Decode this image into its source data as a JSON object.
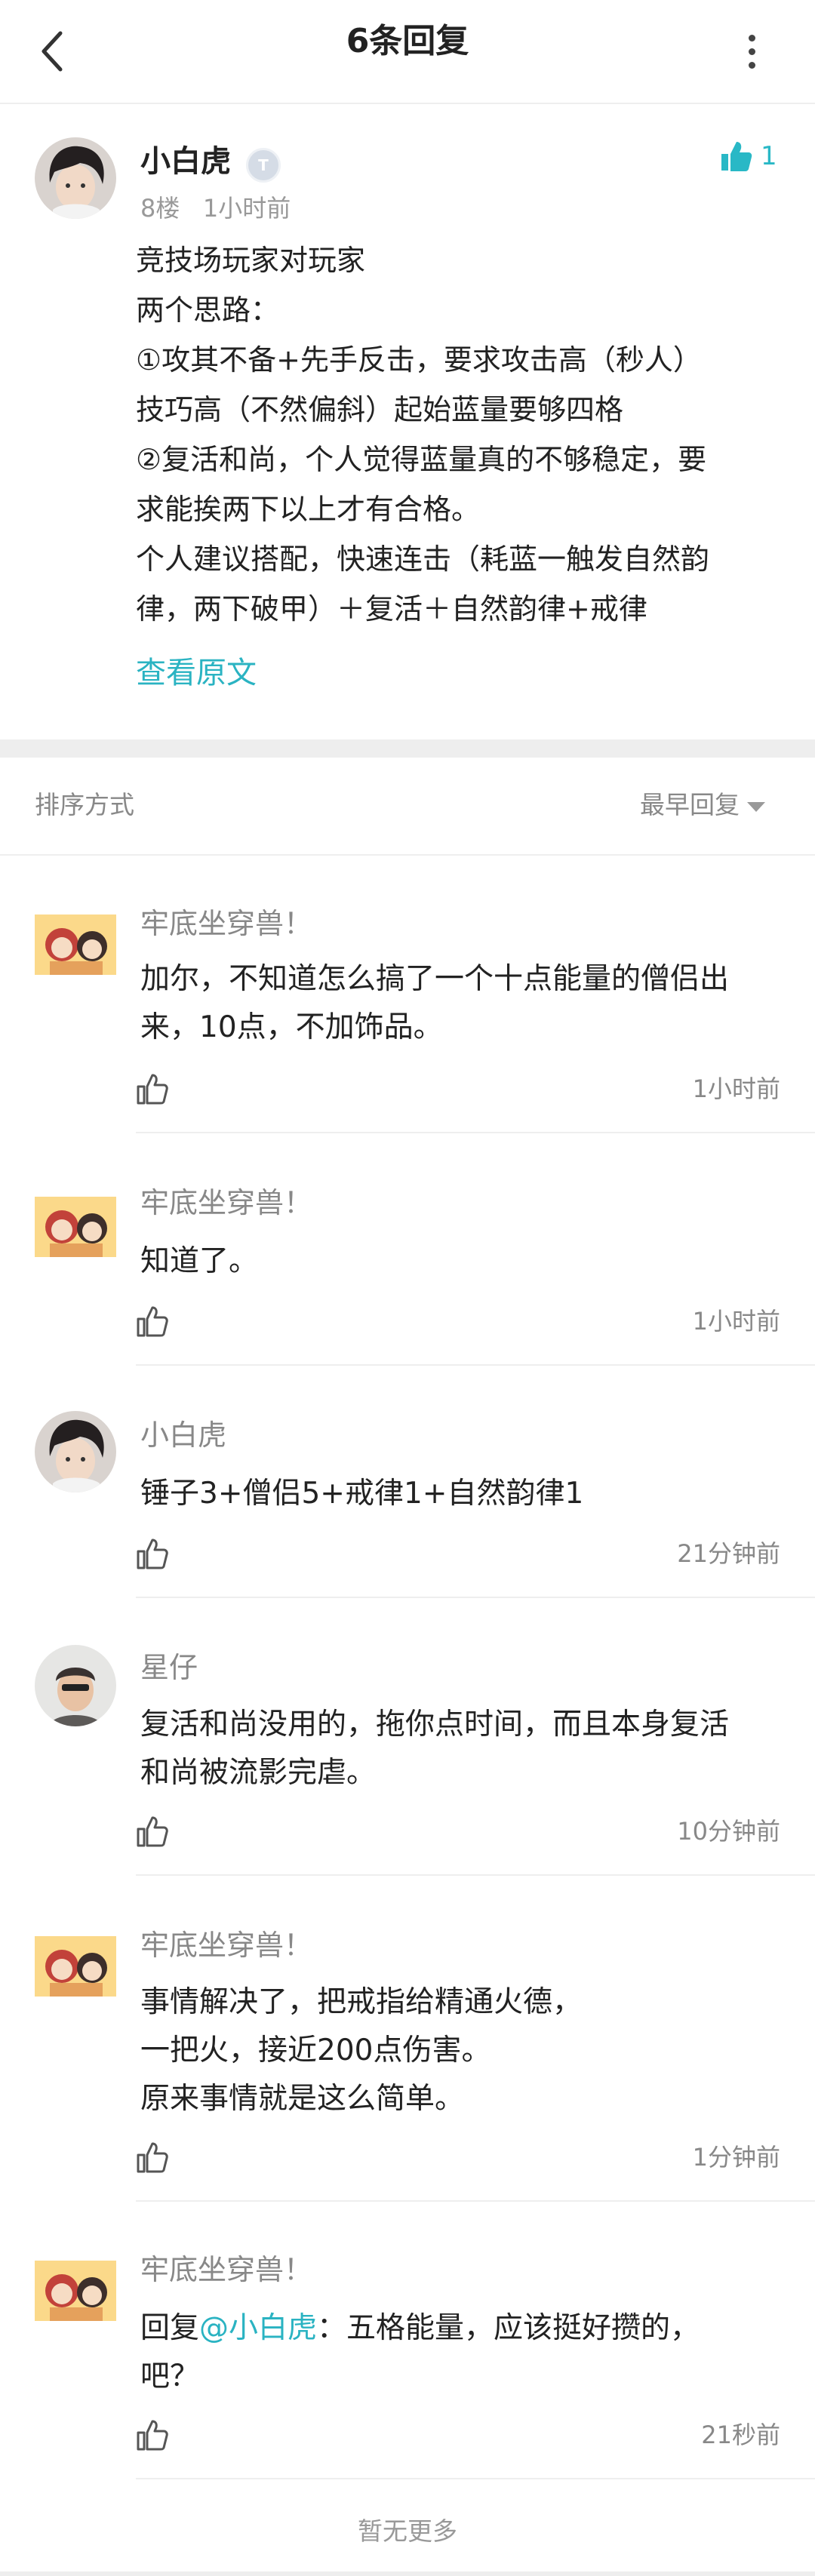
{
  "header": {
    "title": "6条回复",
    "back_icon": "chevron-left-icon",
    "more_icon": "more-vertical-icon"
  },
  "post": {
    "author": "小白虎",
    "badge_icon": "level-badge-icon",
    "floor": "8楼",
    "time": "1小时前",
    "likes": "1",
    "lines": [
      "竞技场玩家对玩家",
      "两个思路：",
      "①攻其不备+先手反击，要求攻击高（秒人）",
      "技巧高（不然偏斜）起始蓝量要够四格",
      "②复活和尚，个人觉得蓝量真的不够稳定，要",
      "求能挨两下以上才有合格。",
      "个人建议搭配，快速连击（耗蓝一触发自然韵",
      "律，两下破甲）＋复活＋自然韵律+戒律"
    ],
    "view_original": "查看原文"
  },
  "sort": {
    "label": "排序方式",
    "value": "最早回复"
  },
  "replies": [
    {
      "author": "牢底坐穿兽！",
      "lines": [
        "加尔，不知道怎么搞了一个十点能量的僧侣出",
        "来，10点，不加饰品。"
      ],
      "time": "1小时前"
    },
    {
      "author": "牢底坐穿兽！",
      "lines": [
        "知道了。"
      ],
      "time": "1小时前"
    },
    {
      "author": "小白虎",
      "lines": [
        "锤子3+僧侣5+戒律1+自然韵律1"
      ],
      "time": "21分钟前"
    },
    {
      "author": "星仔",
      "lines": [
        "复活和尚没用的，拖你点时间，而且本身复活",
        "和尚被流影完虐。"
      ],
      "time": "10分钟前"
    },
    {
      "author": "牢底坐穿兽！",
      "lines": [
        "事情解决了，把戒指给精通火德，",
        "一把火，接近200点伤害。",
        "原来事情就是这么简单。"
      ],
      "time": "1分钟前"
    },
    {
      "author": "牢底坐穿兽！",
      "reply_prefix": "回复",
      "mention": "@小白虎",
      "lines": [
        "：五格能量，应该挺好攒的，",
        "吧？"
      ],
      "time": "21秒前"
    }
  ],
  "footer": {
    "no_more": "暂无更多"
  },
  "colors": {
    "accent": "#2ab3c2",
    "muted": "#888888",
    "divider": "#eeeeee"
  }
}
